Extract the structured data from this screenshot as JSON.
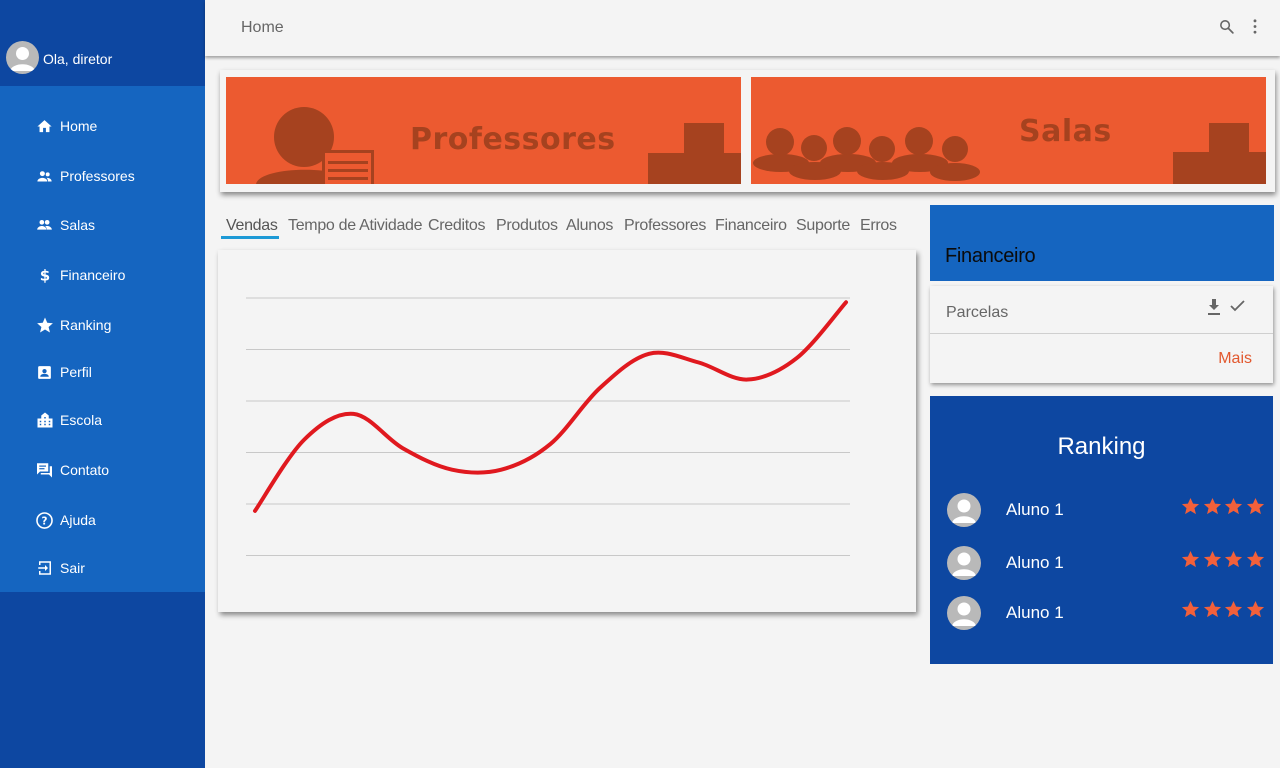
{
  "sidebar": {
    "greeting": "Ola, diretor",
    "items": [
      {
        "label": "Home",
        "icon": "home-icon"
      },
      {
        "label": "Professores",
        "icon": "people-icon"
      },
      {
        "label": "Salas",
        "icon": "group-icon"
      },
      {
        "label": "Financeiro",
        "icon": "dollar-icon"
      },
      {
        "label": "Ranking",
        "icon": "star-icon"
      },
      {
        "label": "Perfil",
        "icon": "profile-card-icon"
      },
      {
        "label": "Escola",
        "icon": "building-icon"
      },
      {
        "label": "Contato",
        "icon": "chat-icon"
      },
      {
        "label": "Ajuda",
        "icon": "help-icon"
      },
      {
        "label": "Sair",
        "icon": "exit-icon"
      }
    ]
  },
  "topbar": {
    "title": "Home",
    "icons": [
      "search-icon",
      "more-vert-icon"
    ]
  },
  "banners": [
    {
      "title": "Professores",
      "icon": "teacher-illustration"
    },
    {
      "title": "Salas",
      "icon": "classroom-illustration"
    }
  ],
  "tabs": [
    "Vendas",
    "Tempo de Atividade",
    "Creditos",
    "Produtos",
    "Alunos",
    "Professores",
    "Financeiro",
    "Suporte",
    "Erros"
  ],
  "active_tab": "Vendas",
  "chart_data": {
    "type": "line",
    "title": "",
    "xlabel": "",
    "ylabel": "",
    "gridlines": 6,
    "grid": true,
    "x": [
      0,
      1,
      2,
      3,
      4,
      5,
      6,
      7,
      8,
      9,
      10,
      11,
      12
    ],
    "series": [
      {
        "values": [
          0.52,
          1.35,
          1.65,
          1.25,
          1.0,
          1.0,
          1.3,
          1.95,
          2.35,
          2.25,
          2.05,
          2.3,
          2.95
        ],
        "color": "#e0191f"
      }
    ],
    "ylim": [
      0,
      3.6
    ]
  },
  "financeiro": {
    "title": "Financeiro",
    "item_label": "Parcelas",
    "item_icons": [
      "download-icon",
      "check-icon"
    ],
    "more_label": "Mais",
    "header_color": "#1565c0",
    "more_color": "#e2582e"
  },
  "ranking": {
    "title": "Ranking",
    "rows": [
      {
        "name": "Aluno 1",
        "stars": 4
      },
      {
        "name": "Aluno 1",
        "stars": 4
      },
      {
        "name": "Aluno 1",
        "stars": 4
      }
    ],
    "star_color": "#f2603a"
  },
  "colors": {
    "sidebar_dark": "#0d47a1",
    "sidebar_nav": "#1565c0",
    "banner": "#ec5a30",
    "tab_underline": "#1e9ad6",
    "background": "#f4f4f4"
  }
}
